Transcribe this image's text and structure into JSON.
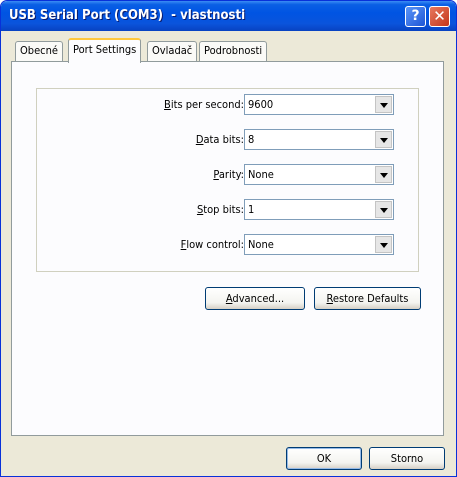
{
  "window": {
    "title": "USB Serial Port (COM3)  - vlastnosti"
  },
  "title_buttons": {
    "help": "?",
    "close": "✕"
  },
  "tabs": [
    {
      "label": "Obecné",
      "active": false
    },
    {
      "label": "Port Settings",
      "active": true
    },
    {
      "label": "Ovladač",
      "active": false
    },
    {
      "label": "Podrobnosti",
      "active": false
    }
  ],
  "settings": [
    {
      "mnemonic": "B",
      "label_rest": "its per second:",
      "value": "9600"
    },
    {
      "mnemonic": "D",
      "label_rest": "ata bits:",
      "value": "8"
    },
    {
      "mnemonic": "P",
      "label_rest": "arity:",
      "value": "None"
    },
    {
      "mnemonic": "S",
      "label_rest": "top bits:",
      "value": "1"
    },
    {
      "mnemonic": "F",
      "label_rest": "low control:",
      "value": "None"
    }
  ],
  "buttons": {
    "advanced": {
      "mnemonic": "A",
      "rest": "dvanced..."
    },
    "restore": {
      "mnemonic": "R",
      "rest": "estore Defaults"
    },
    "ok": "OK",
    "cancel": "Storno"
  }
}
